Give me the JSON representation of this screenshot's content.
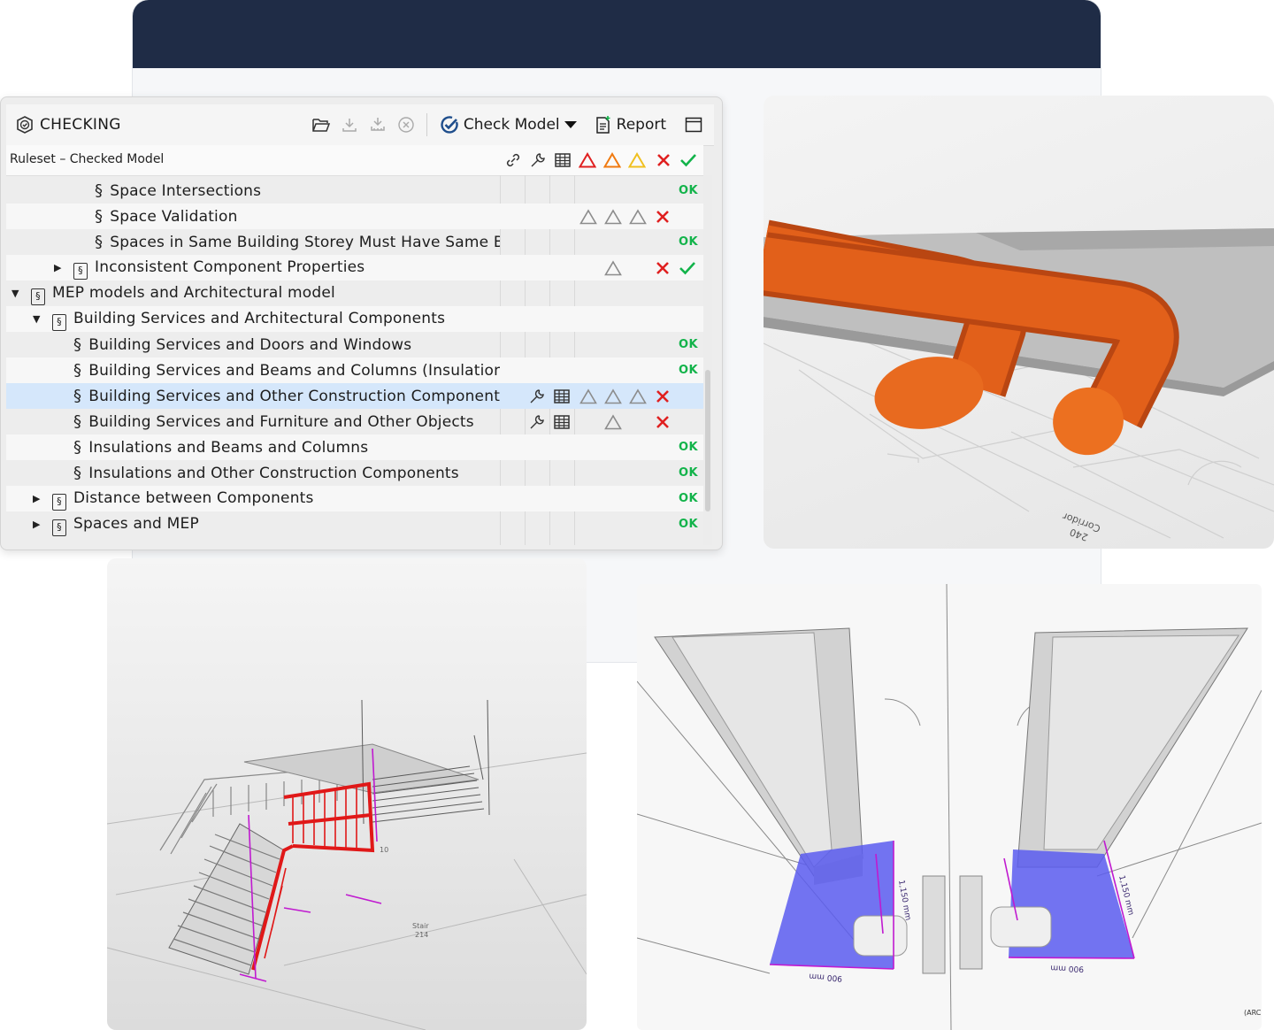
{
  "panel": {
    "title": "CHECKING",
    "check_model_label": "Check Model",
    "report_label": "Report",
    "column_header": "Ruleset – Checked Model"
  },
  "status": {
    "ok_label": "OK"
  },
  "colors": {
    "error_red": "#e02020",
    "warning_orange": "#f07a10",
    "warning_yellow": "#f0c020",
    "ok_green": "#12b34a",
    "selected_row": "#d5e7fb",
    "header_navy": "#1f2c46",
    "pipe_orange": "#e2601a",
    "area_blue": "#5b5cf0"
  },
  "rows": [
    {
      "label": "Space Intersections",
      "kind": "rule",
      "status": "ok"
    },
    {
      "label": "Space Validation",
      "kind": "rule",
      "status": "issues"
    },
    {
      "label": "Spaces in Same Building Storey Must Have Same Bott",
      "kind": "rule",
      "status": "ok"
    },
    {
      "label": "Inconsistent Component Properties",
      "kind": "ruleset",
      "expanded": false,
      "status": "mixed"
    },
    {
      "label": "MEP models and Architectural model",
      "kind": "ruleset",
      "expanded": true
    },
    {
      "label": "Building Services and Architectural Components",
      "kind": "ruleset",
      "expanded": true
    },
    {
      "label": "Building Services and Doors and Windows",
      "kind": "rule",
      "status": "ok"
    },
    {
      "label": "Building Services and Beams and Columns (Insulations",
      "kind": "rule",
      "status": "ok"
    },
    {
      "label": "Building Services and Other Construction Components",
      "kind": "rule",
      "status": "issues",
      "selected": true
    },
    {
      "label": "Building Services and Furniture and Other Objects",
      "kind": "rule",
      "status": "issues"
    },
    {
      "label": "Insulations and Beams and Columns",
      "kind": "rule",
      "status": "ok"
    },
    {
      "label": "Insulations and Other Construction Components",
      "kind": "rule",
      "status": "ok"
    },
    {
      "label": "Distance between Components",
      "kind": "ruleset",
      "expanded": false,
      "status": "ok"
    },
    {
      "label": "Spaces and MEP",
      "kind": "ruleset",
      "expanded": false,
      "status": "ok"
    }
  ],
  "views": {
    "pipes": {
      "room_label": "Corridor",
      "room_number": "240"
    },
    "stairs": {
      "room_label": "Stair",
      "room_number": "214",
      "step_number": "10"
    },
    "doors": {
      "dim_depth_left": "1,150 mm",
      "dim_width_left": "900 mm",
      "dim_depth_right": "1,150 mm",
      "dim_width_right": "900 mm",
      "corner_label": "(ARC)"
    }
  },
  "icons": [
    "checking-icon",
    "folder-open-icon",
    "download-icon",
    "download-all-icon",
    "cancel-icon",
    "check-model-icon",
    "report-icon",
    "window-icon",
    "link-icon",
    "wrench-icon",
    "table-icon",
    "triangle-red-icon",
    "triangle-orange-icon",
    "triangle-yellow-icon",
    "cross-icon",
    "checkmark-icon",
    "section-icon",
    "ruleset-icon"
  ]
}
